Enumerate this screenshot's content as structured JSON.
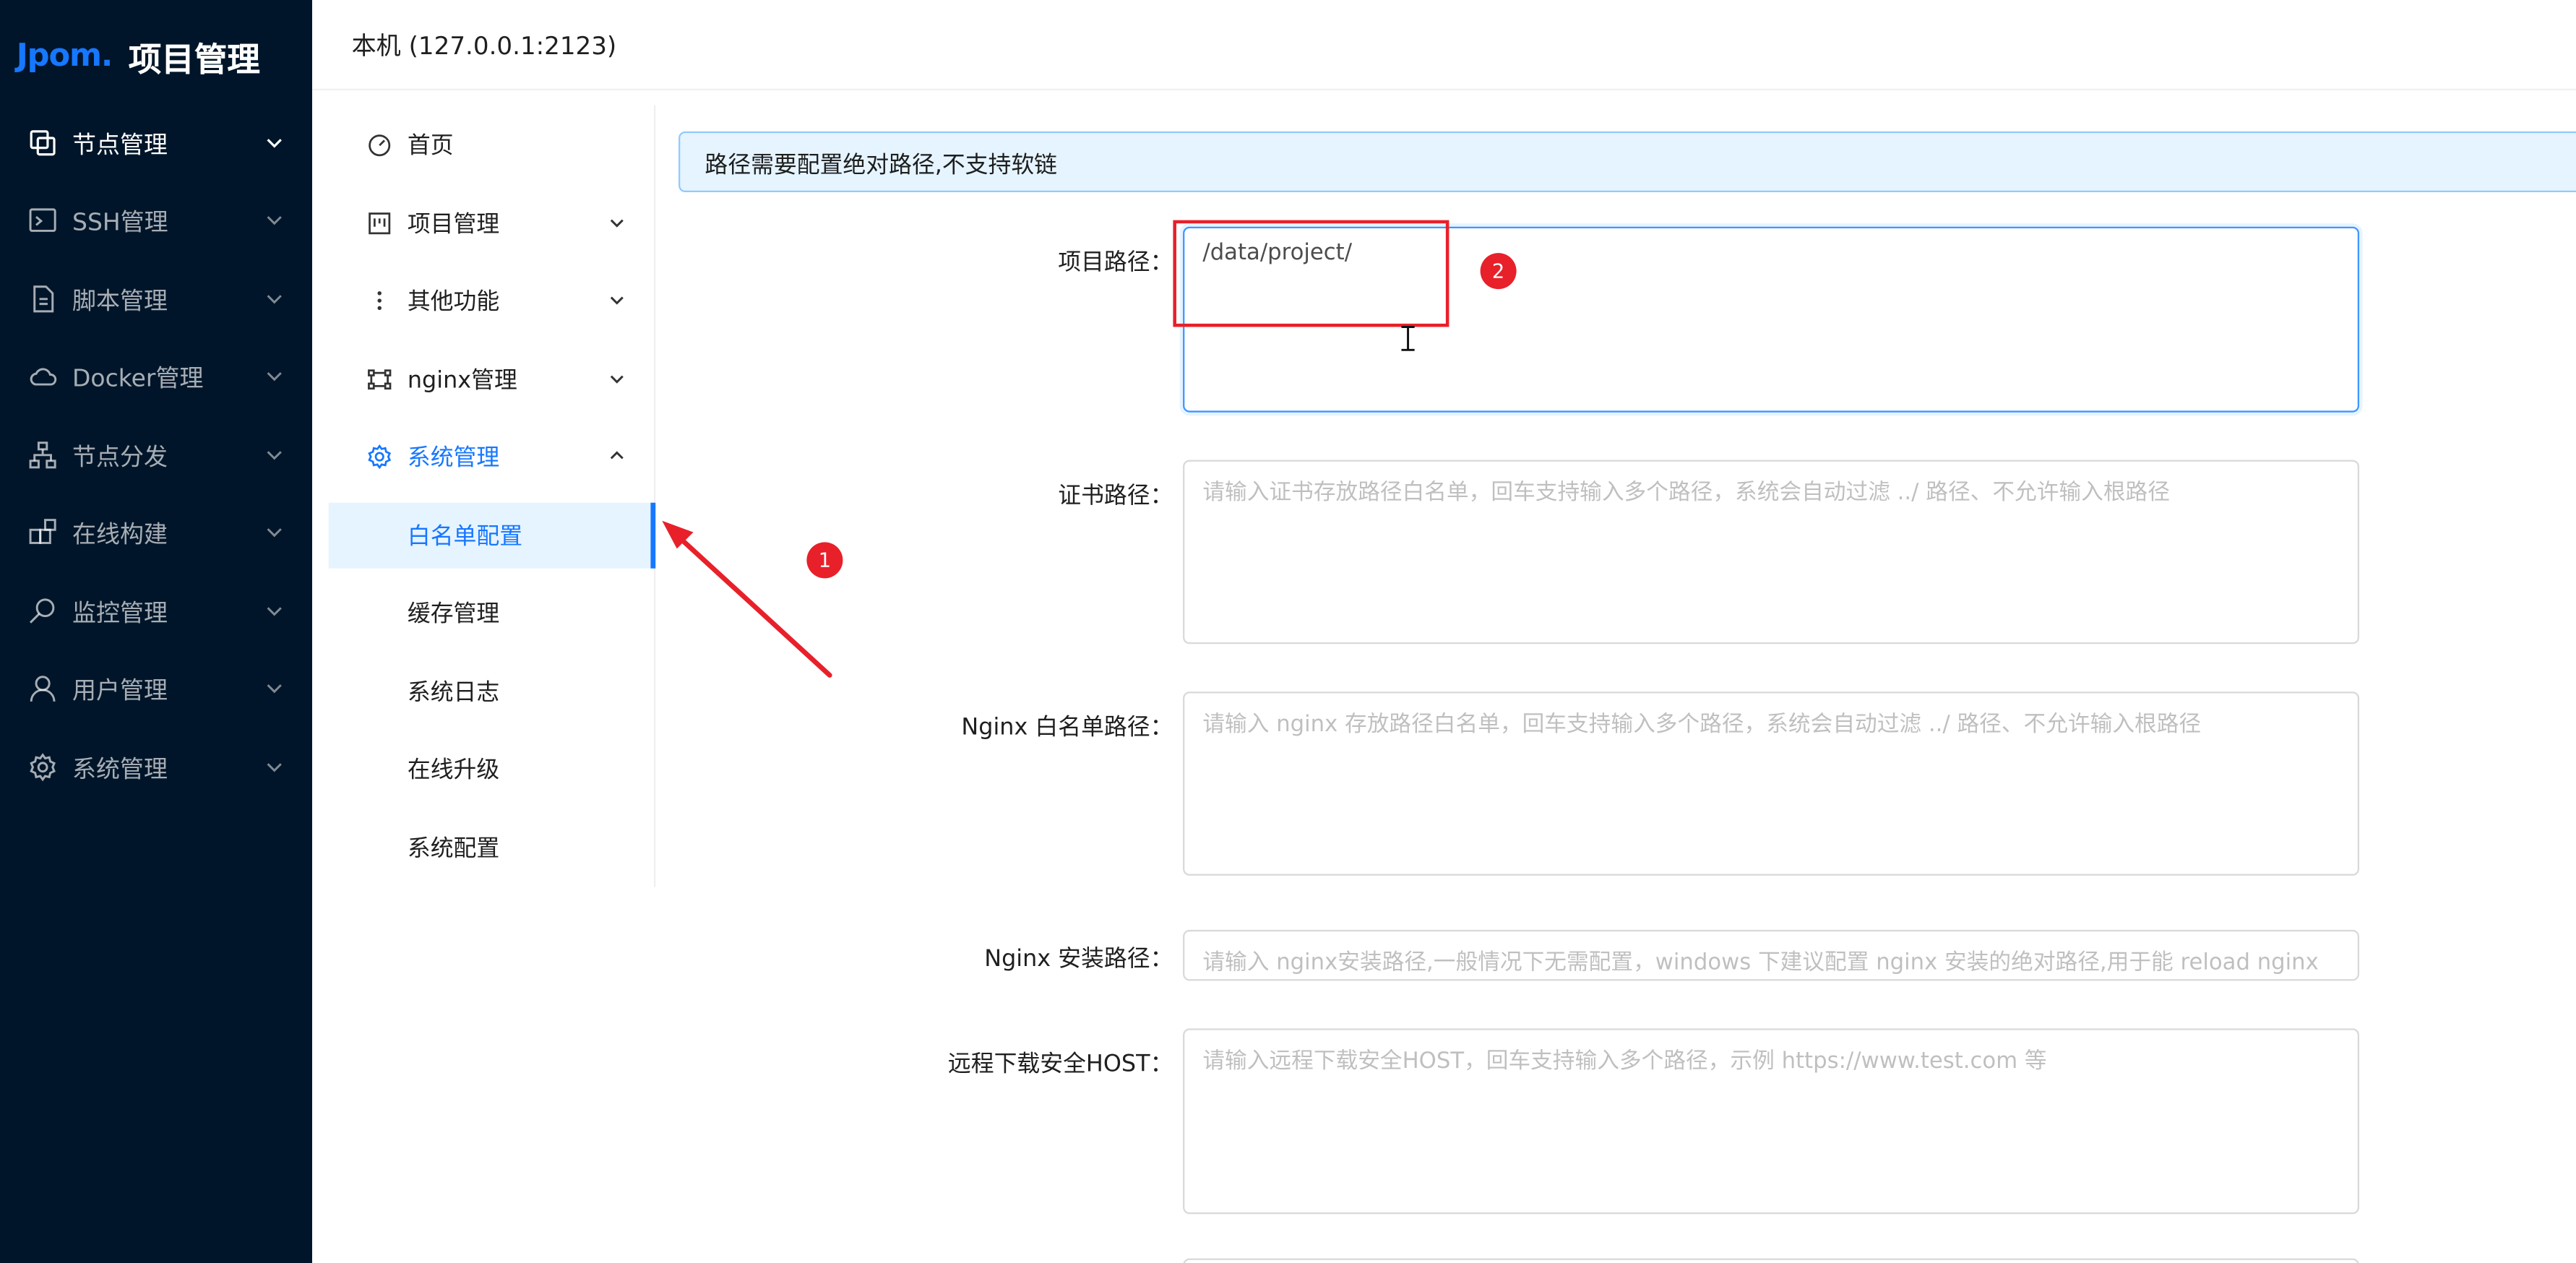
{
  "sidebar": {
    "logo": "Jpom.",
    "title": "项目管理",
    "items": [
      {
        "label": "节点管理",
        "icon": "copy-icon"
      },
      {
        "label": "SSH管理",
        "icon": "terminal-icon"
      },
      {
        "label": "脚本管理",
        "icon": "file-icon"
      },
      {
        "label": "Docker管理",
        "icon": "cloud-icon"
      },
      {
        "label": "节点分发",
        "icon": "apartment-icon"
      },
      {
        "label": "在线构建",
        "icon": "build-icon"
      },
      {
        "label": "监控管理",
        "icon": "monitor-search-icon"
      },
      {
        "label": "用户管理",
        "icon": "user-icon"
      },
      {
        "label": "系统管理",
        "icon": "gear-icon"
      }
    ]
  },
  "header": {
    "title": "本机 (127.0.0.1:2123)"
  },
  "inner_menu": {
    "items": [
      {
        "label": "首页",
        "icon": "dashboard-icon"
      },
      {
        "label": "项目管理",
        "icon": "project-icon"
      },
      {
        "label": "其他功能",
        "icon": "more-icon"
      },
      {
        "label": "nginx管理",
        "icon": "nginx-icon"
      },
      {
        "label": "系统管理",
        "icon": "gear-icon"
      }
    ],
    "sub_items": [
      "白名单配置",
      "缓存管理",
      "系统日志",
      "在线升级",
      "系统配置"
    ]
  },
  "alert": {
    "message": "路径需要配置绝对路径,不支持软链"
  },
  "form": {
    "project_path": {
      "label": "项目路径",
      "value": "/data/project/"
    },
    "cert_path": {
      "label": "证书路径",
      "placeholder": "请输入证书存放路径白名单，回车支持输入多个路径，系统会自动过滤 ../ 路径、不允许输入根路径"
    },
    "nginx_whitelist": {
      "label": "Nginx 白名单路径",
      "placeholder": "请输入 nginx 存放路径白名单，回车支持输入多个路径，系统会自动过滤 ../ 路径、不允许输入根路径"
    },
    "nginx_install": {
      "label": "Nginx 安装路径",
      "placeholder": "请输入 nginx安装路径,一般情况下无需配置，windows 下建议配置 nginx 安装的绝对路径,用于能 reload nginx"
    },
    "remote_host": {
      "label": "远程下载安全HOST",
      "placeholder": "请输入远程下载安全HOST，回车支持输入多个路径，示例 https://www.test.com 等"
    }
  },
  "annotations": {
    "badge1": "1",
    "badge2": "2"
  },
  "colors": {
    "sider_bg": "#001529",
    "primary": "#1677ff",
    "annotation": "#e8202a"
  }
}
